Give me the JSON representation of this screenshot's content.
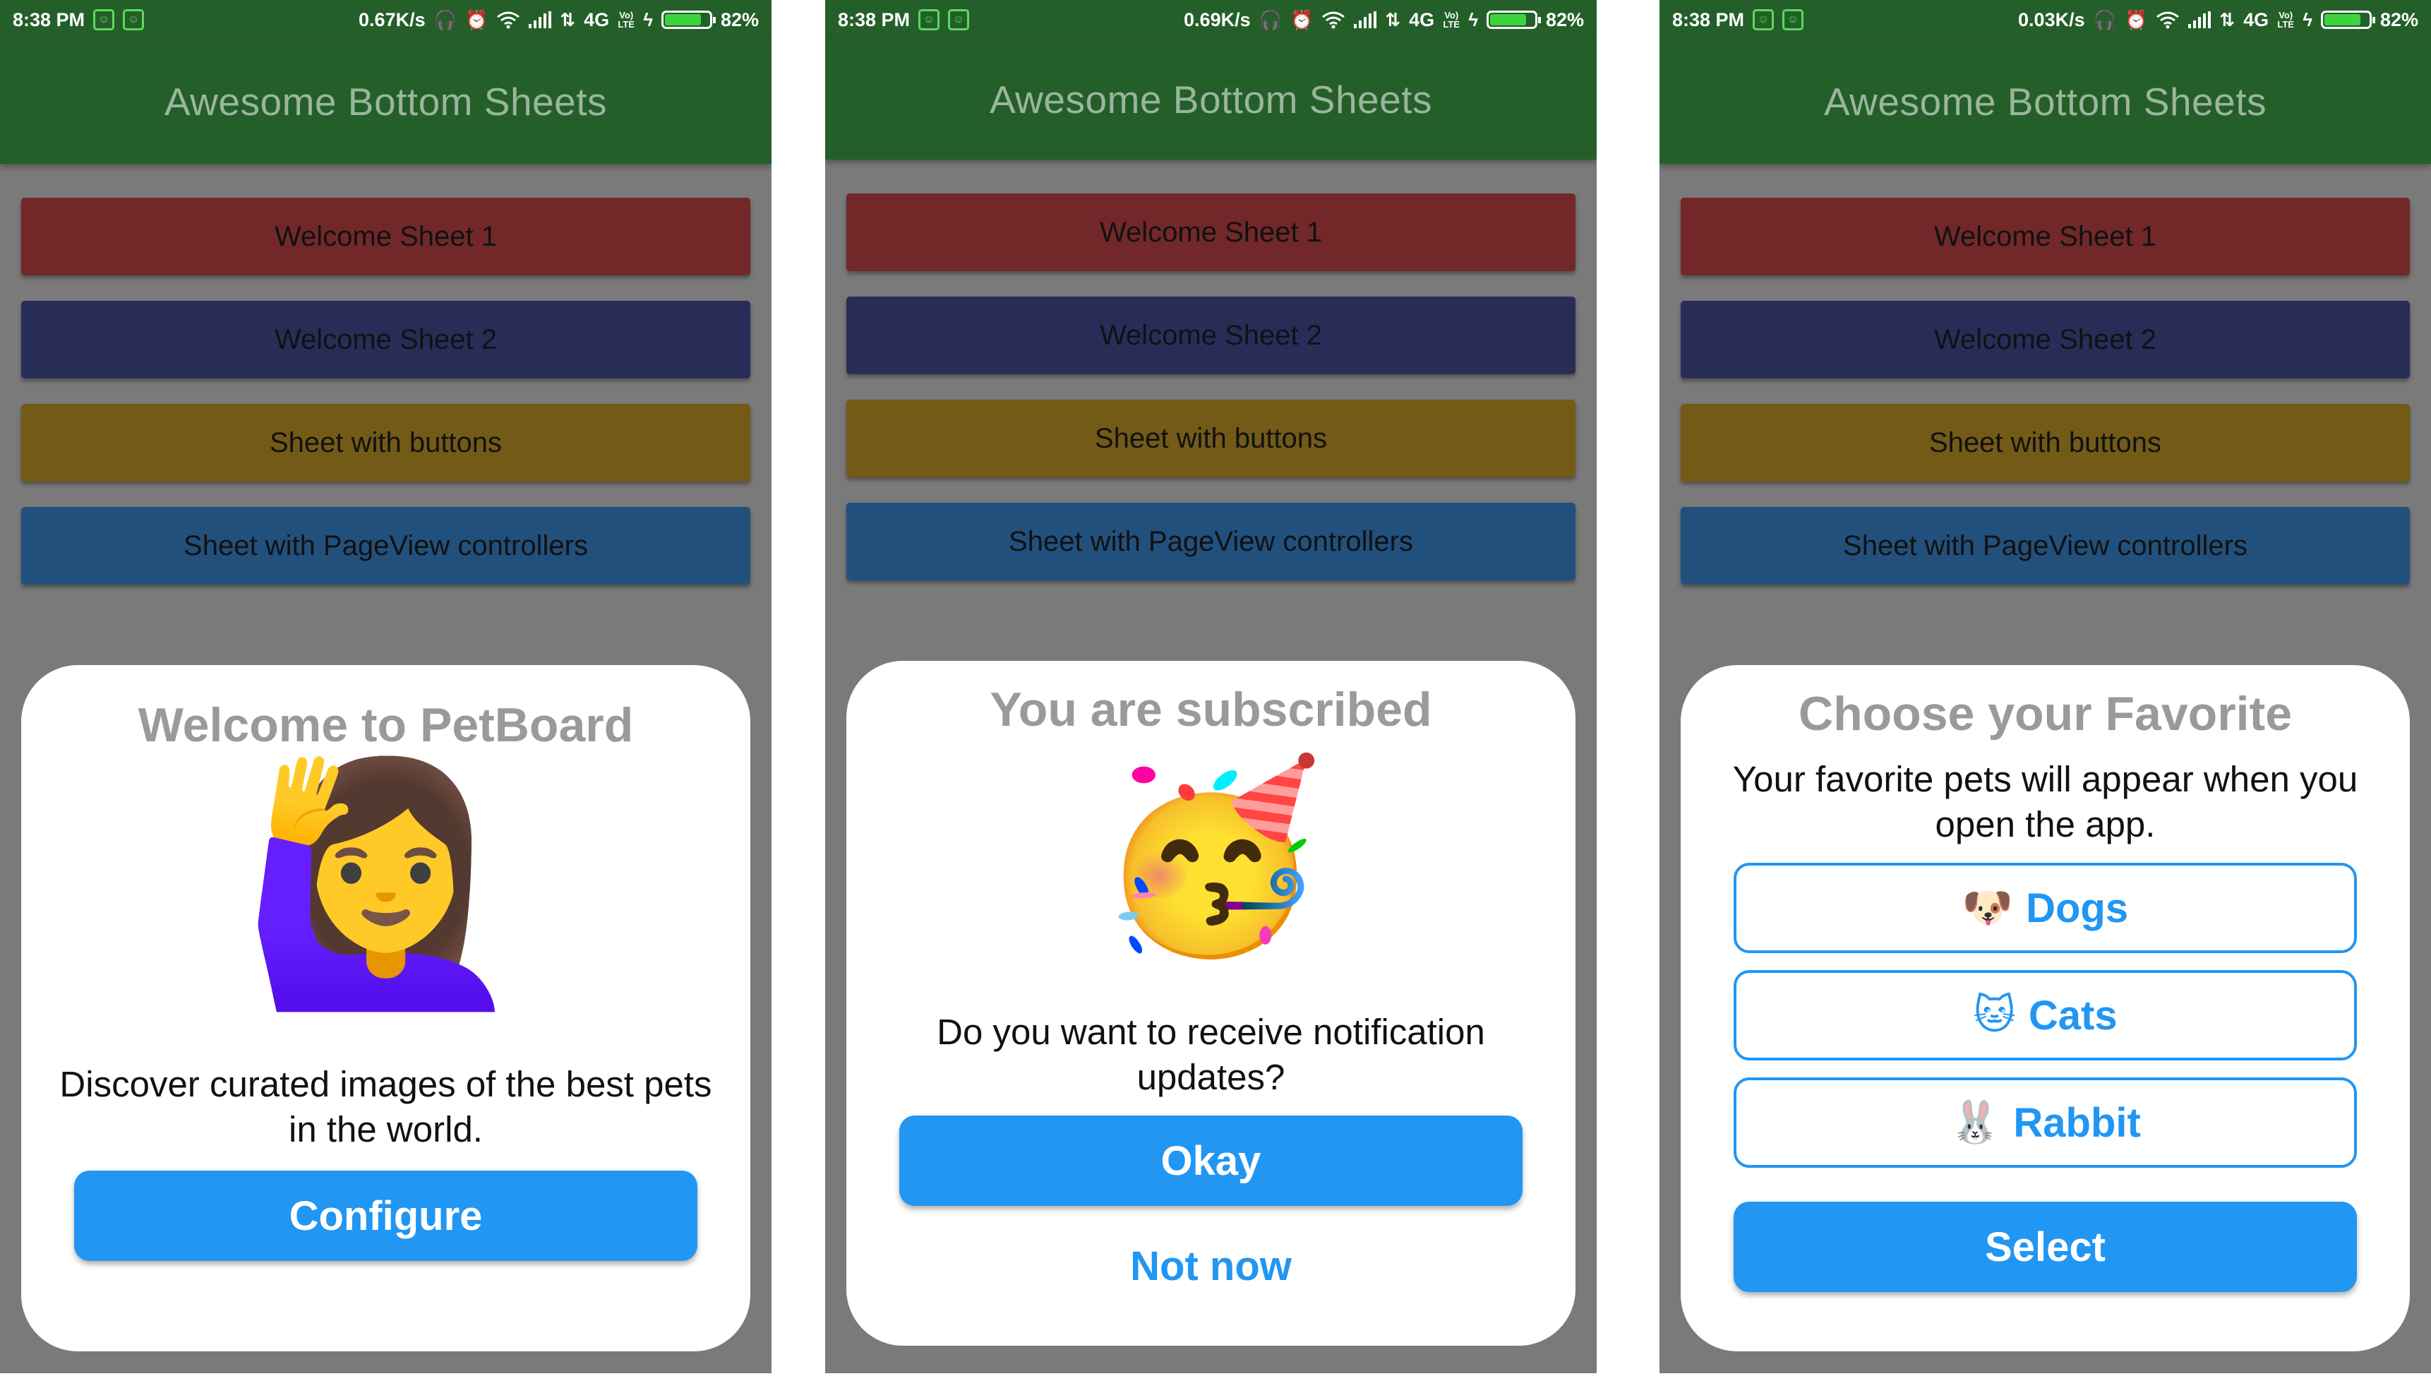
{
  "phones": [
    {
      "status": {
        "time": "8:38 PM",
        "speed": "0.67K/s",
        "network": "4G",
        "volte": "Vo) LTE",
        "battery": "82%",
        "battery_level": 0.82
      },
      "app_title": "Awesome Bottom Sheets",
      "buttons": [
        "Welcome Sheet 1",
        "Welcome Sheet 2",
        "Sheet with buttons",
        "Sheet with PageView controllers"
      ],
      "sheet": {
        "title": "Welcome to PetBoard",
        "emoji": "🙋‍♀️",
        "emoji_name": "woman-raising-hand-icon",
        "text": "Discover curated images of the best pets in the world.",
        "primary": "Configure"
      }
    },
    {
      "status": {
        "time": "8:38 PM",
        "speed": "0.69K/s",
        "network": "4G",
        "volte": "Vo) LTE",
        "battery": "82%",
        "battery_level": 0.82
      },
      "app_title": "Awesome Bottom Sheets",
      "buttons": [
        "Welcome Sheet 1",
        "Welcome Sheet 2",
        "Sheet with buttons",
        "Sheet with PageView controllers"
      ],
      "sheet": {
        "title": "You are subscribed",
        "emoji": "🥳",
        "emoji_name": "partying-face-icon",
        "text": "Do you want to receive notification updates?",
        "primary": "Okay",
        "secondary": "Not now"
      }
    },
    {
      "status": {
        "time": "8:38 PM",
        "speed": "0.03K/s",
        "network": "4G",
        "volte": "Vo) LTE",
        "battery": "82%",
        "battery_level": 0.82
      },
      "app_title": "Awesome Bottom Sheets",
      "buttons": [
        "Welcome Sheet 1",
        "Welcome Sheet 2",
        "Sheet with buttons",
        "Sheet with PageView controllers"
      ],
      "sheet": {
        "title": "Choose your Favorite",
        "text": "Your favorite pets will appear when you open the app.",
        "options": [
          {
            "emoji": "🐶",
            "label": "Dogs"
          },
          {
            "emoji": "🐱",
            "label": "Cats"
          },
          {
            "emoji": "🐰",
            "label": "Rabbit"
          }
        ],
        "primary": "Select"
      }
    }
  ],
  "colors": {
    "status_bar": "#245f2a",
    "app_bar_text": "#9bb59d",
    "overlay": "#7a7a7a",
    "button_colors": [
      "#722828",
      "#282d58",
      "#735a16",
      "#22507c"
    ],
    "accent": "#2196f3",
    "sheet_title": "#9a9a9a"
  }
}
